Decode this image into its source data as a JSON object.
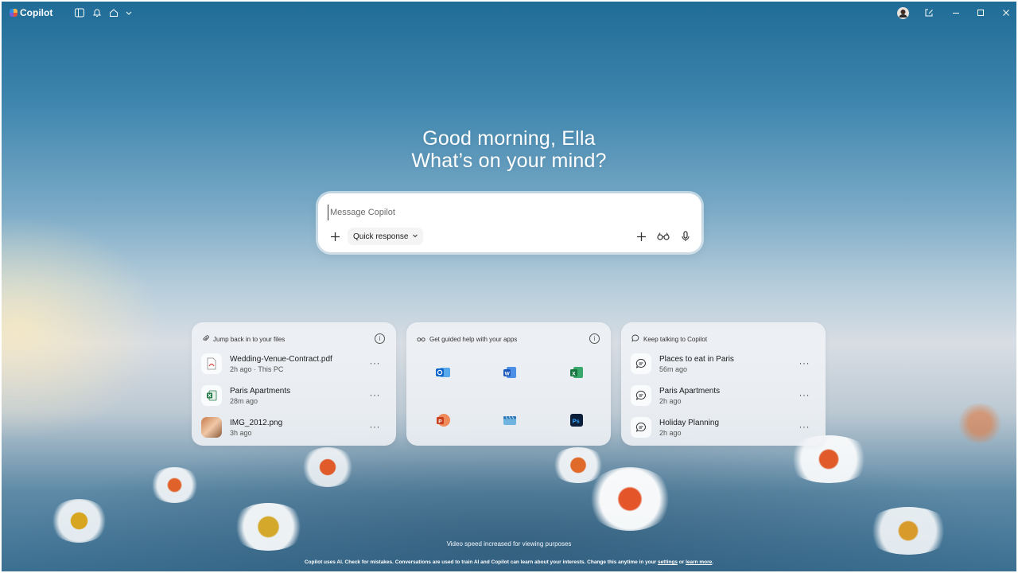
{
  "app": {
    "title": "Copilot"
  },
  "greeting": {
    "line1": "Good morning, Ella",
    "line2": "What’s on your mind?"
  },
  "composer": {
    "placeholder": "Message Copilot",
    "mode_label": "Quick response"
  },
  "cards": {
    "files": {
      "title": "Jump back in to your files",
      "items": [
        {
          "name": "Wedding-Venue-Contract.pdf",
          "meta": "2h ago · This PC",
          "icon": "pdf-file-icon"
        },
        {
          "name": "Paris Apartments",
          "meta": "28m ago",
          "icon": "excel-file-icon"
        },
        {
          "name": "IMG_2012.png",
          "meta": "3h ago",
          "icon": "image-thumbnail"
        }
      ]
    },
    "apps": {
      "title": "Get guided help with your apps",
      "items": [
        "outlook-icon",
        "word-icon",
        "excel-icon",
        "powerpoint-icon",
        "clipchamp-icon",
        "photoshop-icon"
      ]
    },
    "chats": {
      "title": "Keep talking to Copilot",
      "items": [
        {
          "name": "Places to eat in Paris",
          "meta": "56m ago"
        },
        {
          "name": "Paris Apartments",
          "meta": "2h ago"
        },
        {
          "name": "Holiday Planning",
          "meta": "2h ago"
        }
      ]
    }
  },
  "footer": {
    "note": "Video speed increased for viewing purposes",
    "disclaimer": "Copilot uses AI. Check for mistakes. Conversations are used to train AI and Copilot can learn about your interests. Change this anytime in your",
    "settings_link": "settings",
    "or": "or",
    "learn_more": "learn more",
    "end": "."
  },
  "colors": {
    "accent_blue": "#2a7bd6",
    "pdf_red": "#d9453b",
    "excel_green": "#1f7a45",
    "word_blue": "#2b5fb8",
    "ppt_orange": "#d24726",
    "ps_navy": "#0b1e3a"
  }
}
